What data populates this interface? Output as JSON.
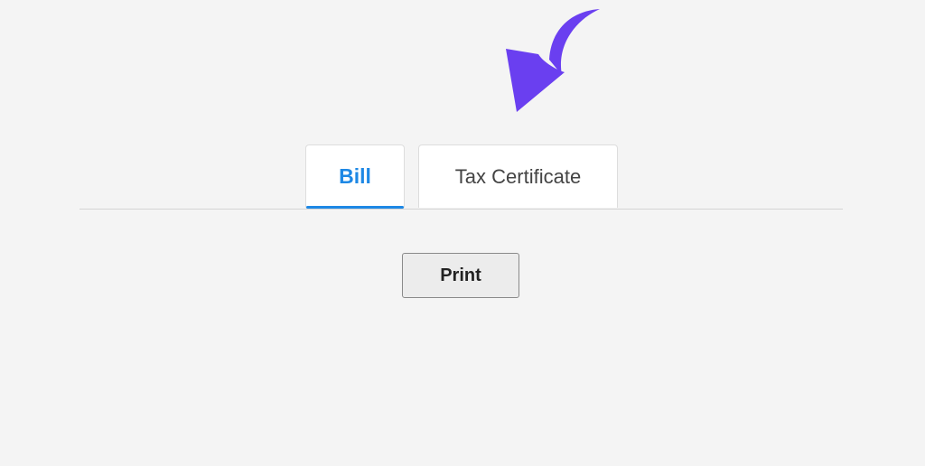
{
  "annotation": {
    "icon": "curved-arrow-icon",
    "color": "#6a3ff0"
  },
  "tabs": [
    {
      "label": "Bill",
      "active": true
    },
    {
      "label": "Tax Certificate",
      "active": false
    }
  ],
  "actions": {
    "print_label": "Print"
  },
  "colors": {
    "accent": "#1e88e5",
    "background": "#f4f4f4"
  }
}
